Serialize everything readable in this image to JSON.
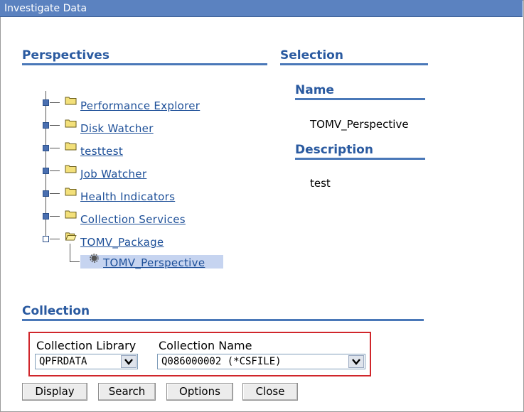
{
  "window": {
    "title": "Investigate Data"
  },
  "perspectives": {
    "heading": "Perspectives",
    "items": [
      {
        "label": "Performance Explorer"
      },
      {
        "label": "Disk Watcher"
      },
      {
        "label": "testtest"
      },
      {
        "label": "Job Watcher"
      },
      {
        "label": "Health Indicators"
      },
      {
        "label": "Collection Services"
      },
      {
        "label": "TOMV_Package",
        "expanded": true,
        "children": [
          {
            "label": "TOMV_Perspective",
            "selected": true
          }
        ]
      }
    ]
  },
  "selection": {
    "heading": "Selection",
    "name_heading": "Name",
    "name_value": "TOMV_Perspective",
    "description_heading": "Description",
    "description_value": "test"
  },
  "collection": {
    "heading": "Collection",
    "library_label": "Collection Library",
    "library_value": "QPFRDATA",
    "name_label": "Collection Name",
    "name_value": "Q086000002 (*CSFILE)"
  },
  "buttons": {
    "display": "Display",
    "search": "Search",
    "options": "Options",
    "close": "Close"
  },
  "colors": {
    "title_bar": "#5b82c0",
    "heading": "#2a5aa0",
    "link": "#1d4f98",
    "highlight": "#c6d4f0",
    "annotation_box": "#d0262b"
  }
}
